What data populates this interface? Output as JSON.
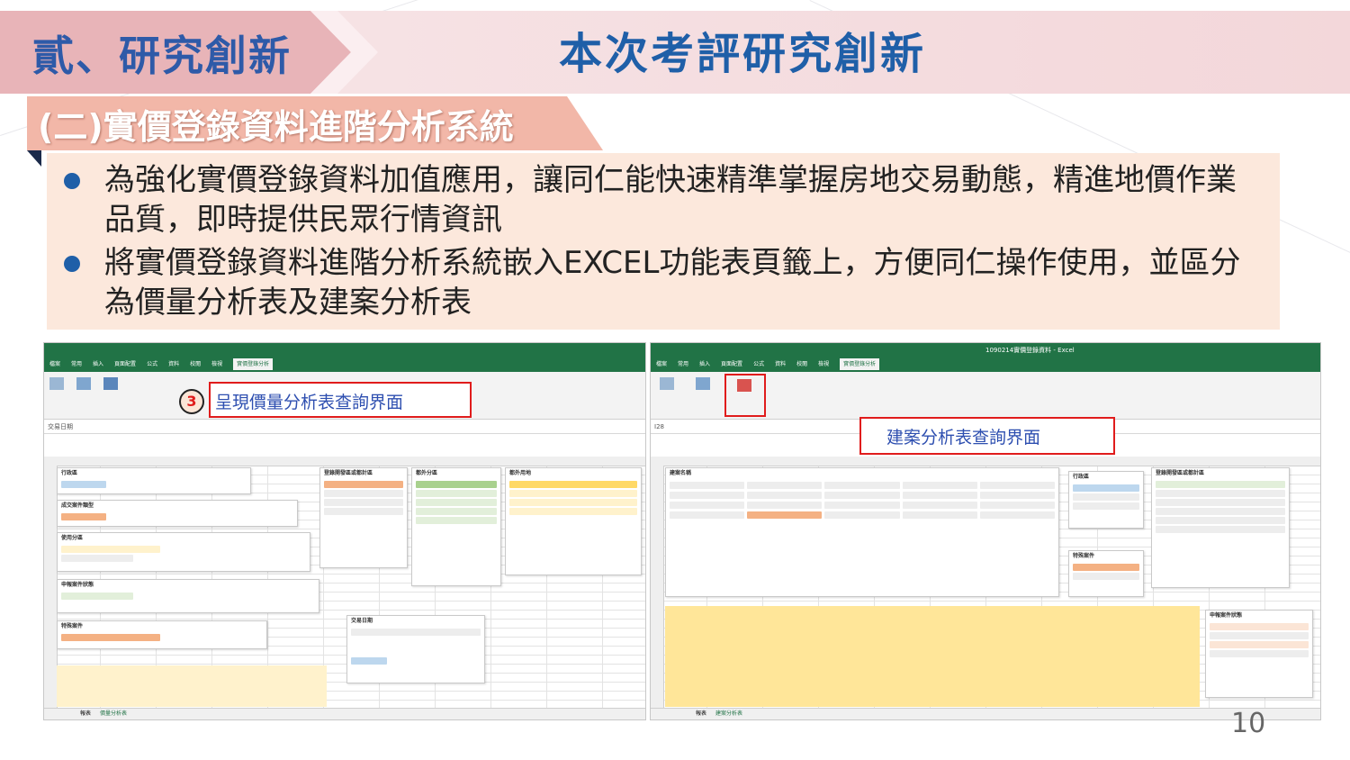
{
  "header": {
    "section_title": "貳、研究創新",
    "main_title": "本次考評研究創新",
    "sub_title": "(二)實價登錄資料進階分析系統"
  },
  "bullets": [
    "為強化實價登錄資料加值應用，讓同仁能快速精準掌握房地交易動態，精進地價作業品質，即時提供民眾行情資訊",
    "將實價登錄資料進階分析系統嵌入EXCEL功能表頁籤上，方便同仁操作使用，並區分為價量分析表及建案分析表"
  ],
  "left_excel": {
    "callout_number": "3",
    "callout_text": "呈現價量分析表查詢界面",
    "cell_ref": "交易日期",
    "sheet_tabs": [
      "報表",
      "價量分析表"
    ]
  },
  "right_excel": {
    "title": "1090214實價登錄資料 - Excel",
    "callout_text": "建案分析表查詢界面",
    "cell_ref": "I28",
    "sheet_tabs": [
      "報表",
      "建案分析表"
    ]
  },
  "page_number": "10",
  "colors": {
    "title_blue": "#1f5fa8",
    "excel_green": "#217346",
    "callout_red": "#e01c1c",
    "banner_pink": "#e8b4b8",
    "bullet_bg": "#fce8dc"
  }
}
